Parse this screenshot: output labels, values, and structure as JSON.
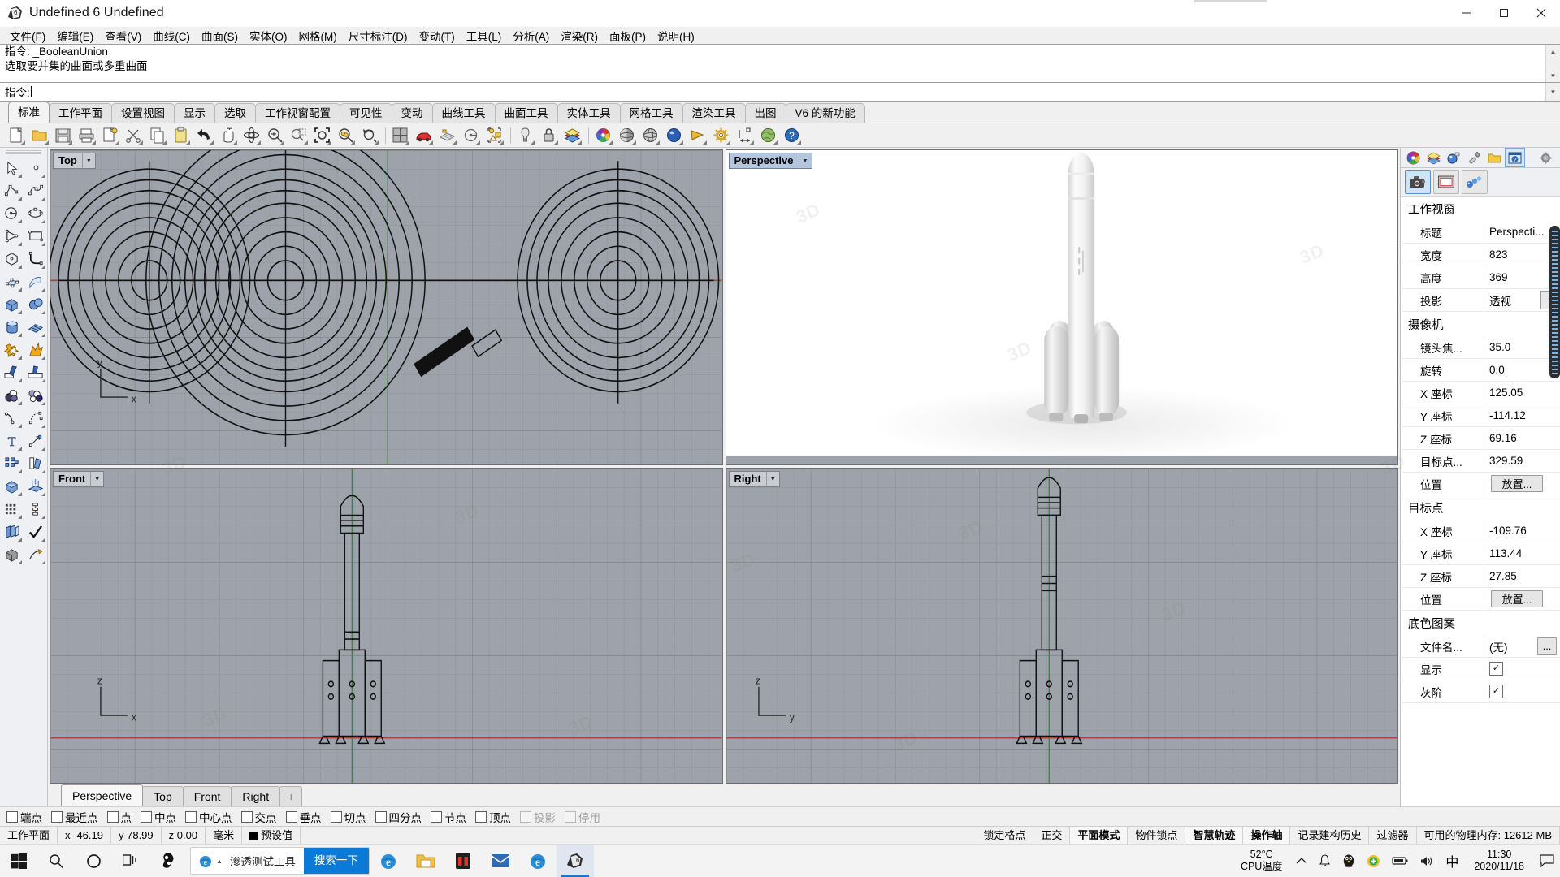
{
  "window": {
    "title": "Undefined 6 Undefined",
    "app_icon": "rhino-logo-icon",
    "minimize": "—",
    "maximize": "☐",
    "close": "✕"
  },
  "menubar": {
    "items": [
      {
        "label": "文件(F)",
        "name": "menu-file"
      },
      {
        "label": "编辑(E)",
        "name": "menu-edit"
      },
      {
        "label": "查看(V)",
        "name": "menu-view"
      },
      {
        "label": "曲线(C)",
        "name": "menu-curve"
      },
      {
        "label": "曲面(S)",
        "name": "menu-surface"
      },
      {
        "label": "实体(O)",
        "name": "menu-solid"
      },
      {
        "label": "网格(M)",
        "name": "menu-mesh"
      },
      {
        "label": "尺寸标注(D)",
        "name": "menu-dimension"
      },
      {
        "label": "变动(T)",
        "name": "menu-transform"
      },
      {
        "label": "工具(L)",
        "name": "menu-tools"
      },
      {
        "label": "分析(A)",
        "name": "menu-analyze"
      },
      {
        "label": "渲染(R)",
        "name": "menu-render"
      },
      {
        "label": "面板(P)",
        "name": "menu-panels"
      },
      {
        "label": "说明(H)",
        "name": "menu-help"
      }
    ]
  },
  "command": {
    "history_line1": "指令: _BooleanUnion",
    "history_line2": "选取要并集的曲面或多重曲面",
    "prompt_label": "指令:",
    "prompt_value": ""
  },
  "toolbar_tabs": {
    "items": [
      {
        "label": "标准",
        "active": true
      },
      {
        "label": "工作平面",
        "active": false
      },
      {
        "label": "设置视图",
        "active": false
      },
      {
        "label": "显示",
        "active": false
      },
      {
        "label": "选取",
        "active": false
      },
      {
        "label": "工作视窗配置",
        "active": false
      },
      {
        "label": "可见性",
        "active": false
      },
      {
        "label": "变动",
        "active": false
      },
      {
        "label": "曲线工具",
        "active": false
      },
      {
        "label": "曲面工具",
        "active": false
      },
      {
        "label": "实体工具",
        "active": false
      },
      {
        "label": "网格工具",
        "active": false
      },
      {
        "label": "渲染工具",
        "active": false
      },
      {
        "label": "出图",
        "active": false
      },
      {
        "label": "V6 的新功能",
        "active": false
      }
    ]
  },
  "icon_toolbar": {
    "items": [
      {
        "name": "new-file-icon",
        "glyph": "page"
      },
      {
        "name": "open-file-icon",
        "glyph": "folder"
      },
      {
        "name": "save-file-icon",
        "glyph": "floppy"
      },
      {
        "name": "print-icon",
        "glyph": "printer"
      },
      {
        "name": "properties-icon",
        "glyph": "props"
      },
      {
        "name": "cut-icon",
        "glyph": "scissors"
      },
      {
        "name": "copy-icon",
        "glyph": "copy"
      },
      {
        "name": "paste-icon",
        "glyph": "clipboard"
      },
      {
        "name": "undo-icon",
        "glyph": "undo"
      },
      {
        "name": "pan-icon",
        "glyph": "hand"
      },
      {
        "name": "rotate-view-icon",
        "glyph": "orbit"
      },
      {
        "name": "zoom-in-icon",
        "glyph": "zoomin"
      },
      {
        "name": "zoom-window-icon",
        "glyph": "zoomwin"
      },
      {
        "name": "zoom-extents-icon",
        "glyph": "zoomext"
      },
      {
        "name": "zoom-selected-icon",
        "glyph": "zoomsel"
      },
      {
        "name": "zoom-previous-icon",
        "glyph": "zoomprev"
      },
      {
        "name": "viewport-layout-icon",
        "glyph": "fourview"
      },
      {
        "name": "render-preview-icon",
        "glyph": "car"
      },
      {
        "name": "cplane-icon",
        "glyph": "grid"
      },
      {
        "name": "named-view-icon",
        "glyph": "namedview"
      },
      {
        "name": "layer-state-icon",
        "glyph": "layerdot"
      },
      {
        "name": "light-icon",
        "glyph": "bulb"
      },
      {
        "name": "lock-icon",
        "glyph": "lock"
      },
      {
        "name": "layers-icon",
        "glyph": "layers"
      },
      {
        "name": "color-wheel-icon",
        "glyph": "colorwheel"
      },
      {
        "name": "shaded-view-icon",
        "glyph": "sphere-shade"
      },
      {
        "name": "ghosted-view-icon",
        "glyph": "sphere-ghost"
      },
      {
        "name": "rendered-view-icon",
        "glyph": "sphere-blue"
      },
      {
        "name": "render-icon",
        "glyph": "cone"
      },
      {
        "name": "options-icon",
        "glyph": "gear"
      },
      {
        "name": "dimension-icon",
        "glyph": "dim"
      },
      {
        "name": "earth-icon",
        "glyph": "earth"
      },
      {
        "name": "help-icon",
        "glyph": "help"
      }
    ]
  },
  "left_toolbar": {
    "rows": [
      [
        {
          "name": "select-tool-icon"
        },
        {
          "name": "point-tool-icon"
        }
      ],
      [
        {
          "name": "polyline-tool-icon"
        },
        {
          "name": "curve-tool-icon"
        }
      ],
      [
        {
          "name": "circle-tool-icon"
        },
        {
          "name": "ellipse-tool-icon"
        }
      ],
      [
        {
          "name": "arc-tool-icon"
        },
        {
          "name": "rectangle-tool-icon"
        }
      ],
      [
        {
          "name": "polygon-tool-icon"
        },
        {
          "name": "fillet-curve-icon"
        }
      ],
      [
        {
          "name": "surface-from-points-icon"
        },
        {
          "name": "surface-sweep-icon"
        }
      ],
      [
        {
          "name": "box-solid-icon"
        },
        {
          "name": "sphere-solid-icon"
        }
      ],
      [
        {
          "name": "cylinder-solid-icon"
        },
        {
          "name": "mesh-plane-icon"
        }
      ],
      [
        {
          "name": "boolean-union-icon"
        },
        {
          "name": "explode-icon"
        }
      ],
      [
        {
          "name": "trim-icon"
        },
        {
          "name": "split-icon"
        }
      ],
      [
        {
          "name": "boolean-tools-icon"
        },
        {
          "name": "boolean-difference-icon"
        }
      ],
      [
        {
          "name": "offset-curve-icon"
        },
        {
          "name": "rebuild-curve-icon"
        }
      ],
      [
        {
          "name": "text-tool-icon"
        },
        {
          "name": "scale-tool-icon"
        }
      ],
      [
        {
          "name": "array-tool-icon"
        },
        {
          "name": "mirror-tool-icon"
        }
      ],
      [
        {
          "name": "cap-solid-icon"
        },
        {
          "name": "extrude-icon"
        }
      ],
      [
        {
          "name": "grid-array-icon"
        },
        {
          "name": "dimension-tool-icon"
        }
      ],
      [
        {
          "name": "layer-tool-icon"
        },
        {
          "name": "check-tool-icon"
        }
      ],
      [
        {
          "name": "render-material-icon"
        },
        {
          "name": "render-light-icon"
        }
      ]
    ]
  },
  "viewports": [
    {
      "label": "Top",
      "name": "viewport-top",
      "active": false
    },
    {
      "label": "Perspective",
      "name": "viewport-perspective",
      "active": true
    },
    {
      "label": "Front",
      "name": "viewport-front",
      "active": false
    },
    {
      "label": "Right",
      "name": "viewport-right",
      "active": false
    }
  ],
  "viewport_tabs": {
    "items": [
      {
        "label": "Perspective",
        "active": true
      },
      {
        "label": "Top",
        "active": false
      },
      {
        "label": "Front",
        "active": false
      },
      {
        "label": "Right",
        "active": false
      }
    ],
    "add_label": "+"
  },
  "right_panel": {
    "tabs": [
      {
        "name": "properties-tab-icon",
        "selected": false
      },
      {
        "name": "layers-tab-icon",
        "selected": false
      },
      {
        "name": "materials-tab-icon",
        "selected": false
      },
      {
        "name": "display-tab-icon",
        "selected": false
      },
      {
        "name": "libraries-tab-icon",
        "selected": false
      },
      {
        "name": "help-tab-icon",
        "selected": true
      }
    ],
    "gear": "gear-icon",
    "subtabs": [
      {
        "name": "camera-subtab-icon",
        "selected": true
      },
      {
        "name": "viewport-subtab-icon",
        "selected": false
      },
      {
        "name": "render-subtab-icon",
        "selected": false
      }
    ],
    "groups": [
      {
        "title": "工作视窗",
        "rows": [
          {
            "key": "标题",
            "value": "Perspecti...",
            "type": "text"
          },
          {
            "key": "宽度",
            "value": "823",
            "type": "text"
          },
          {
            "key": "高度",
            "value": "369",
            "type": "text"
          },
          {
            "key": "投影",
            "value": "透视",
            "type": "combo"
          }
        ]
      },
      {
        "title": "摄像机",
        "rows": [
          {
            "key": "镜头焦...",
            "value": "35.0",
            "type": "text"
          },
          {
            "key": "旋转",
            "value": "0.0",
            "type": "text"
          },
          {
            "key": "X 座标",
            "value": "125.05",
            "type": "text"
          },
          {
            "key": "Y 座标",
            "value": "-114.12",
            "type": "text"
          },
          {
            "key": "Z 座标",
            "value": "69.16",
            "type": "text"
          },
          {
            "key": "目标点...",
            "value": "329.59",
            "type": "text"
          },
          {
            "key": "位置",
            "value": "放置...",
            "type": "button"
          }
        ]
      },
      {
        "title": "目标点",
        "rows": [
          {
            "key": "X 座标",
            "value": "-109.76",
            "type": "text"
          },
          {
            "key": "Y 座标",
            "value": "113.44",
            "type": "text"
          },
          {
            "key": "Z 座标",
            "value": "27.85",
            "type": "text"
          },
          {
            "key": "位置",
            "value": "放置...",
            "type": "button"
          }
        ]
      },
      {
        "title": "底色图案",
        "rows": [
          {
            "key": "文件名...",
            "value": "(无)",
            "type": "filebutton",
            "button": "..."
          },
          {
            "key": "显示",
            "value": "",
            "type": "checkbox",
            "checked": true
          },
          {
            "key": "灰阶",
            "value": "",
            "type": "checkbox",
            "checked": true
          }
        ]
      }
    ]
  },
  "osnap": {
    "items": [
      {
        "label": "端点",
        "disabled": false
      },
      {
        "label": "最近点",
        "disabled": false
      },
      {
        "label": "点",
        "disabled": false
      },
      {
        "label": "中点",
        "disabled": false
      },
      {
        "label": "中心点",
        "disabled": false
      },
      {
        "label": "交点",
        "disabled": false
      },
      {
        "label": "垂点",
        "disabled": false
      },
      {
        "label": "切点",
        "disabled": false
      },
      {
        "label": "四分点",
        "disabled": false
      },
      {
        "label": "节点",
        "disabled": false
      },
      {
        "label": "顶点",
        "disabled": false
      },
      {
        "label": "投影",
        "disabled": true
      },
      {
        "label": "停用",
        "disabled": true
      }
    ]
  },
  "statusbar": {
    "cplane_label": "工作平面",
    "x": "x -46.19",
    "y": "y 78.99",
    "z": "z 0.00",
    "units": "毫米",
    "layer": "预设值",
    "layer_color": "#000000",
    "toggles": [
      {
        "label": "锁定格点",
        "bold": false
      },
      {
        "label": "正交",
        "bold": false
      },
      {
        "label": "平面模式",
        "bold": true
      },
      {
        "label": "物件锁点",
        "bold": false
      },
      {
        "label": "智慧轨迹",
        "bold": true
      },
      {
        "label": "操作轴",
        "bold": true
      },
      {
        "label": "记录建构历史",
        "bold": false
      },
      {
        "label": "过滤器",
        "bold": false
      }
    ],
    "memory": "可用的物理内存: 12612 MB"
  },
  "taskbar": {
    "start": "windows-logo-icon",
    "search_icon": "search-icon",
    "cortana_icon": "cortana-icon",
    "taskview_icon": "task-view-icon",
    "pinned_icon": "sogou-icon",
    "browser_entry": {
      "icon": "ie-icon",
      "label": "渗透测试工具",
      "search_placeholder": "",
      "go_label": "搜索一下"
    },
    "apps": [
      {
        "name": "edge-icon"
      },
      {
        "name": "file-explorer-icon"
      },
      {
        "name": "store-icon"
      },
      {
        "name": "mail-icon"
      },
      {
        "name": "edge2-icon"
      },
      {
        "name": "rhino-icon",
        "active": true
      }
    ],
    "tray": {
      "cpu_temp": "52°C",
      "cpu_label": "CPU温度",
      "chevron": "chevron-up-icon",
      "bell": "notification-bell-icon",
      "qq": "qq-penguin-icon",
      "shield": "security-shield-icon",
      "battery": "battery-icon",
      "volume": "volume-icon",
      "ime": "中",
      "time": "11:30",
      "date": "2020/11/18",
      "action_center": "action-center-icon"
    }
  },
  "watermark": {
    "text": "3D"
  }
}
